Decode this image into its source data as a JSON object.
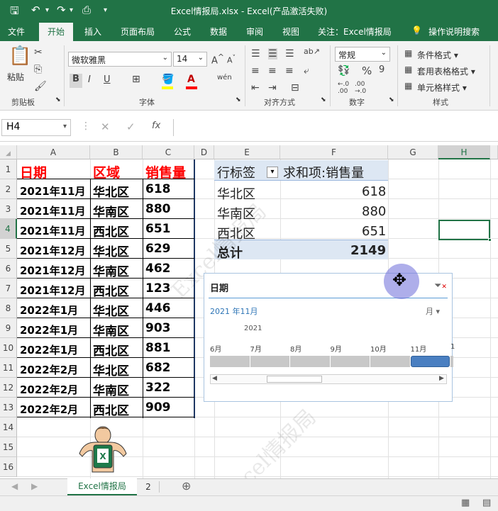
{
  "titlebar": {
    "title": "Excel情报局.xlsx  -  Excel(产品激活失败)",
    "save_icon": "save-icon",
    "undo_icon": "undo-icon",
    "redo_icon": "redo-icon",
    "preview_icon": "print-preview-icon"
  },
  "tabs": [
    "文件",
    "开始",
    "插入",
    "页面布局",
    "公式",
    "数据",
    "审阅",
    "视图",
    "关注：Excel情报局",
    "操作说明搜索"
  ],
  "ribbon": {
    "clipboard": {
      "paste": "粘贴",
      "label": "剪贴板"
    },
    "font": {
      "name": "微软雅黑",
      "size": "14",
      "bold": "B",
      "italic": "I",
      "underline": "U",
      "label": "字体"
    },
    "alignment": {
      "label": "对齐方式"
    },
    "number": {
      "format": "常规",
      "percent": "%",
      "comma": "9",
      "label": "数字"
    },
    "styles": {
      "conditional": "条件格式",
      "table": "套用表格格式",
      "cell": "单元格样式",
      "label": "样式"
    }
  },
  "formula_bar": {
    "name_box": "H4",
    "formula": ""
  },
  "columns": [
    "A",
    "B",
    "C",
    "D",
    "E",
    "F",
    "G",
    "H"
  ],
  "rows": [
    "1",
    "2",
    "3",
    "4",
    "5",
    "6",
    "7",
    "8",
    "9",
    "10",
    "11",
    "12",
    "13",
    "14",
    "15",
    "16"
  ],
  "table": {
    "headers": [
      "日期",
      "区域",
      "销售量"
    ],
    "rows": [
      [
        "2021年11月",
        "华北区",
        "618"
      ],
      [
        "2021年11月",
        "华南区",
        "880"
      ],
      [
        "2021年11月",
        "西北区",
        "651"
      ],
      [
        "2021年12月",
        "华北区",
        "629"
      ],
      [
        "2021年12月",
        "华南区",
        "462"
      ],
      [
        "2021年12月",
        "西北区",
        "123"
      ],
      [
        "2022年1月",
        "华北区",
        "446"
      ],
      [
        "2022年1月",
        "华南区",
        "903"
      ],
      [
        "2022年1月",
        "西北区",
        "881"
      ],
      [
        "2022年2月",
        "华北区",
        "682"
      ],
      [
        "2022年2月",
        "华南区",
        "322"
      ],
      [
        "2022年2月",
        "西北区",
        "909"
      ]
    ]
  },
  "pivot": {
    "row_label": "行标签",
    "value_label": "求和项:销售量",
    "rows": [
      [
        "华北区",
        "618"
      ],
      [
        "华南区",
        "880"
      ],
      [
        "西北区",
        "651"
      ]
    ],
    "total_label": "总计",
    "total_value": "2149"
  },
  "slicer": {
    "title": "日期",
    "selection": "2021 年11月",
    "level": "月",
    "year": "2021",
    "months": [
      "6月",
      "7月",
      "8月",
      "9月",
      "10月",
      "11月",
      "1"
    ],
    "selected_month_index": 5
  },
  "sheets": [
    "Excel情报局",
    "2"
  ],
  "watermark": "Excel情报局"
}
